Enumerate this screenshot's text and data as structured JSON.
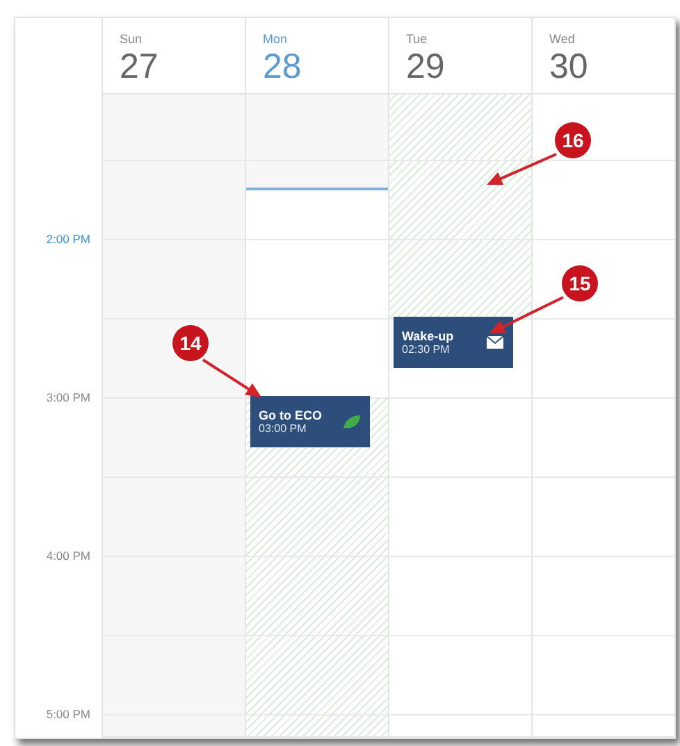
{
  "time_labels": [
    {
      "label": "2:00 PM",
      "current": true
    },
    {
      "label": "3:00 PM",
      "current": false
    },
    {
      "label": "4:00 PM",
      "current": false
    },
    {
      "label": "5:00 PM",
      "current": false
    }
  ],
  "days": [
    {
      "name": "Sun",
      "date": "27",
      "today": false,
      "cells": [
        {
          "kind": "past"
        },
        {
          "kind": "past"
        },
        {
          "kind": "past"
        },
        {
          "kind": "past"
        },
        {
          "kind": "past"
        },
        {
          "kind": "past"
        },
        {
          "kind": "past"
        },
        {
          "kind": "past"
        },
        {
          "kind": "past"
        }
      ]
    },
    {
      "name": "Mon",
      "date": "28",
      "today": true,
      "cells": [
        {
          "kind": "past"
        },
        {
          "kind": "now"
        },
        {
          "kind": "free"
        },
        {
          "kind": "free"
        },
        {
          "kind": "hatched",
          "event": {
            "title": "Go to ECO",
            "time": "03:00 PM",
            "kind": "eco"
          }
        },
        {
          "kind": "hatched"
        },
        {
          "kind": "hatched"
        },
        {
          "kind": "hatched"
        },
        {
          "kind": "hatched"
        }
      ]
    },
    {
      "name": "Tue",
      "date": "29",
      "today": false,
      "cells": [
        {
          "kind": "hatched"
        },
        {
          "kind": "hatched"
        },
        {
          "kind": "hatched"
        },
        {
          "kind": "free",
          "event": {
            "title": "Wake-up",
            "time": "02:30 PM",
            "kind": "message"
          }
        },
        {
          "kind": "free"
        },
        {
          "kind": "free"
        },
        {
          "kind": "free"
        },
        {
          "kind": "free"
        },
        {
          "kind": "free"
        }
      ]
    },
    {
      "name": "Wed",
      "date": "30",
      "today": false,
      "cells": [
        {
          "kind": "free"
        },
        {
          "kind": "free"
        },
        {
          "kind": "free"
        },
        {
          "kind": "free"
        },
        {
          "kind": "free"
        },
        {
          "kind": "free"
        },
        {
          "kind": "free"
        },
        {
          "kind": "free"
        },
        {
          "kind": "free"
        }
      ]
    }
  ],
  "annotations": [
    {
      "number": "16"
    },
    {
      "number": "15"
    },
    {
      "number": "14"
    }
  ]
}
